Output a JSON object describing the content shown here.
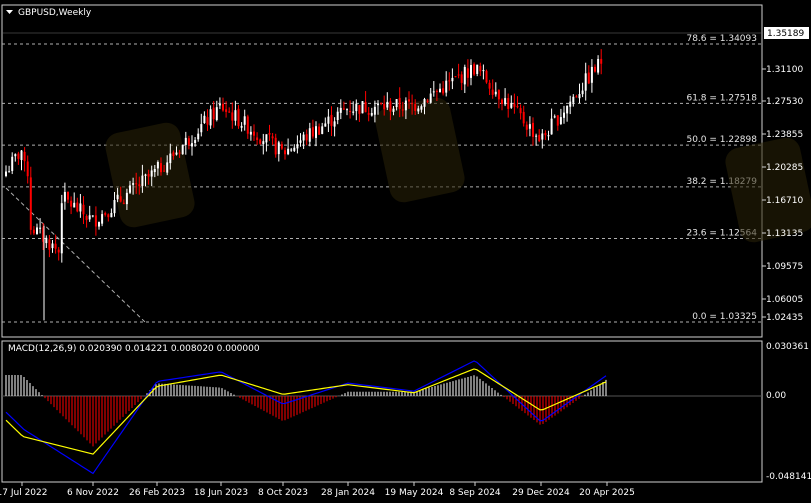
{
  "chart_data": [
    {
      "type": "candlestick",
      "title": "GBPUSD,Weekly",
      "x_ticks": [
        "17 Jul 2022",
        "6 Nov 2022",
        "26 Feb 2023",
        "18 Jun 2023",
        "8 Oct 2023",
        "28 Jan 2024",
        "19 May 2024",
        "8 Sep 2024",
        "29 Dec 2024",
        "20 Apr 2025"
      ],
      "y_ticks": [
        "1.31100",
        "1.27530",
        "1.23855",
        "1.20285",
        "1.16710",
        "1.13135",
        "1.09575",
        "1.06005",
        "1.02435"
      ],
      "ylim": [
        1.01,
        1.372
      ],
      "current_price": "1.35189",
      "fib_levels": [
        {
          "label": "78.6 = 1.34093",
          "value": 1.34093
        },
        {
          "label": "61.8 = 1.27518",
          "value": 1.27518
        },
        {
          "label": "50.0 = 1.22898",
          "value": 1.22898
        },
        {
          "label": "38.2 = 1.18279",
          "value": 1.18279
        },
        {
          "label": "23.6 = 1.12564",
          "value": 1.12564
        },
        {
          "label": "0.0 = 1.03325",
          "value": 1.03325
        }
      ],
      "close_path": [
        [
          "17 Jul 2022",
          1.205
        ],
        [
          "6 Nov 2022",
          1.145
        ],
        [
          "26 Feb 2023",
          1.2005
        ],
        [
          "18 Jun 2023",
          1.272
        ],
        [
          "8 Oct 2023",
          1.2205
        ],
        [
          "28 Jan 2024",
          1.2705
        ],
        [
          "19 May 2024",
          1.273
        ],
        [
          "8 Sep 2024",
          1.315
        ],
        [
          "29 Dec 2024",
          1.235
        ],
        [
          "20 Apr 2025",
          1.3305
        ],
        [
          "latest",
          1.35189
        ]
      ],
      "up_color": "#ffffff",
      "down_color": "#ff0000"
    },
    {
      "type": "macd",
      "title": "MACD(12,26,9) 0.020390 0.014221 0.008020 0.000000",
      "y_ticks": [
        "0.030361",
        "0.00",
        "-0.048141"
      ],
      "ylim": [
        -0.0495,
        0.0318
      ],
      "macd_path": [
        [
          "17 Jul 2022",
          -0.02
        ],
        [
          "6 Nov 2022",
          -0.048
        ],
        [
          "26 Feb 2023",
          0.009
        ],
        [
          "18 Jun 2023",
          0.015
        ],
        [
          "8 Oct 2023",
          -0.005
        ],
        [
          "28 Jan 2024",
          0.008
        ],
        [
          "19 May 2024",
          0.003
        ],
        [
          "8 Sep 2024",
          0.022
        ],
        [
          "29 Dec 2024",
          -0.016
        ],
        [
          "20 Apr 2025",
          0.013
        ],
        [
          "latest",
          0.02039
        ]
      ],
      "signal_path": [
        [
          "17 Jul 2022",
          -0.025
        ],
        [
          "6 Nov 2022",
          -0.036
        ],
        [
          "26 Feb 2023",
          0.006
        ],
        [
          "18 Jun 2023",
          0.013
        ],
        [
          "8 Oct 2023",
          0.001
        ],
        [
          "28 Jan 2024",
          0.007
        ],
        [
          "19 May 2024",
          0.002
        ],
        [
          "8 Sep 2024",
          0.017
        ],
        [
          "29 Dec 2024",
          -0.009
        ],
        [
          "20 Apr 2025",
          0.009
        ],
        [
          "latest",
          0.014221
        ]
      ],
      "macd_color": "#0000ff",
      "signal_color": "#ffff00",
      "hist_up_color": "#ffffff",
      "hist_down_color": "#ff0000"
    }
  ],
  "colors": {
    "background": "#000000",
    "grid": "#808080",
    "axis_text": "#ffffff"
  }
}
